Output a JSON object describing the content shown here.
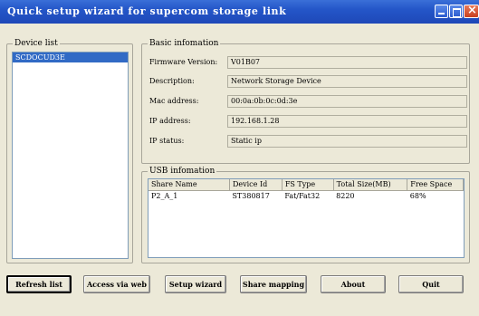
{
  "window": {
    "title": "Quick setup wizard for supercom storage link"
  },
  "device_list": {
    "title": "Device list",
    "items": [
      "SCDOCUD3E"
    ]
  },
  "basic_info": {
    "title": "Basic infomation",
    "firmware_label": "Firmware Version:",
    "firmware_value": "V01B07",
    "description_label": "Description:",
    "description_value": "Network Storage Device",
    "mac_label": "Mac address:",
    "mac_value": "00:0a:0b:0c:0d:3e",
    "ip_label": "IP address:",
    "ip_value": "192.168.1.28",
    "ip_status_label": "IP status:",
    "ip_status_value": "Static ip"
  },
  "usb_info": {
    "title": "USB infomation",
    "columns": [
      "Share Name",
      "Device Id",
      "FS Type",
      "Total Size(MB)",
      "Free Space"
    ],
    "rows": [
      [
        "P2_A_1",
        "ST380817",
        "Fat/Fat32",
        "8220",
        "68%"
      ]
    ]
  },
  "buttons": {
    "refresh": "Refresh list",
    "access": "Access via web",
    "setup": "Setup wizard",
    "share": "Share mapping",
    "about": "About",
    "quit": "Quit"
  }
}
